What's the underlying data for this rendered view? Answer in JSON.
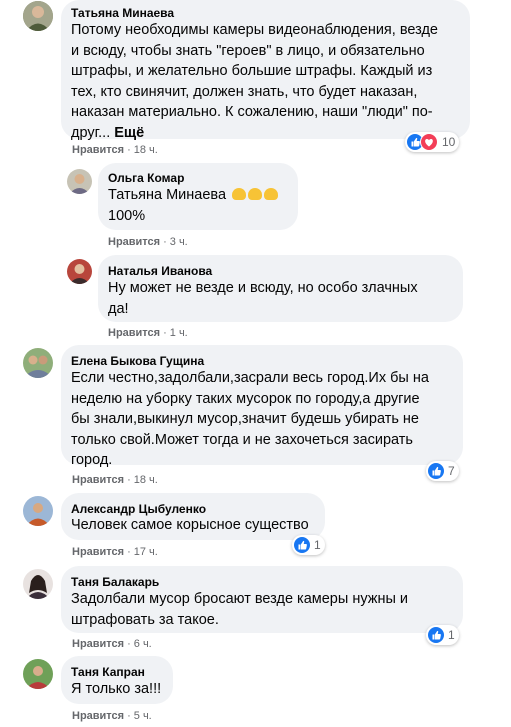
{
  "comments": [
    {
      "author": "Татьяна Минаева",
      "lines": [
        "Потому необходимы камеры видеонаблюдения, везде",
        "и всюду, чтобы знать \"героев\" в лицо, и обязательно",
        "штрафы, и желательно большие штрафы. Каждый из",
        "тех, кто свинячит, должен знать, что будет наказан,",
        "наказан материально. К сожалению, наши \"люди\" по-",
        "друг..."
      ],
      "more": "Ещё",
      "like": "Нравится",
      "time": "18 ч.",
      "reactions": "10"
    },
    {
      "author": "Ольга Комар",
      "mention": "Татьяна Минаева",
      "lines": [
        "100%"
      ],
      "like": "Нравится",
      "time": "3 ч."
    },
    {
      "author": "Наталья Иванова",
      "lines": [
        "Ну может не везде и всюду, но особо злачных",
        "да!"
      ],
      "like": "Нравится",
      "time": "1 ч."
    },
    {
      "author": "Елена Быкова Гущина",
      "lines": [
        "Если честно,задолбали,засрали весь город.Их бы на",
        "неделю на уборку таких мусорок по городу,а другие",
        "бы знали,выкинул мусор,значит будешь убирать не",
        "только свой.Может тогда и не захочеться засирать",
        "город."
      ],
      "like": "Нравится",
      "time": "18 ч.",
      "reactions": "7"
    },
    {
      "author": "Александр Цыбуленко",
      "lines": [
        "Человек самое корысное существо"
      ],
      "like": "Нравится",
      "time": "17 ч.",
      "reactions": "1"
    },
    {
      "author": "Таня Балакарь",
      "lines": [
        "Задолбали мусор бросают везде камеры нужны и",
        "штрафовать за такое."
      ],
      "like": "Нравится",
      "time": "6 ч.",
      "reactions": "1"
    },
    {
      "author": "Таня Капран",
      "lines": [
        "Я только за!!!"
      ],
      "like": "Нравится",
      "time": "5 ч."
    }
  ],
  "colors": {
    "bubble": "#f0f2f5",
    "like_blue": "#1877f2",
    "love_red": "#f33e58",
    "meta_gray": "#65676b"
  }
}
